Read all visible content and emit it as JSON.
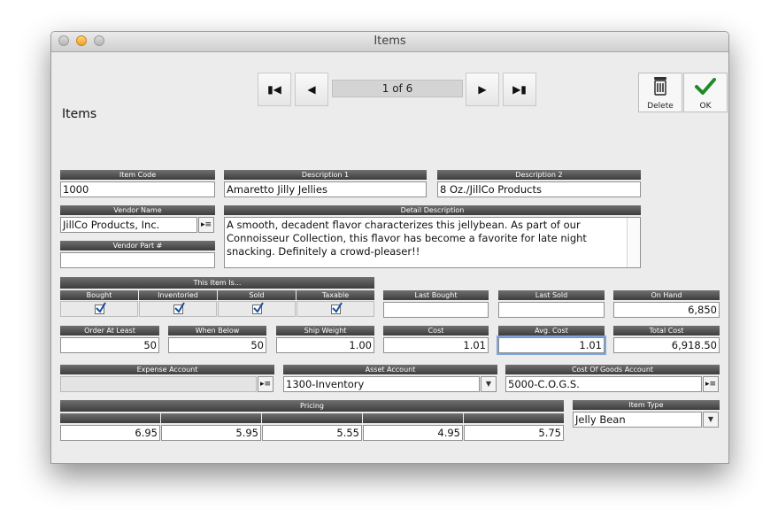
{
  "window": {
    "title": "Items"
  },
  "navigation": {
    "record_position": "1 of 6"
  },
  "toolbar": {
    "delete_label": "Delete",
    "ok_label": "OK"
  },
  "page": {
    "heading": "Items"
  },
  "fields": {
    "item_code": {
      "label": "Item Code",
      "value": "1000"
    },
    "description1": {
      "label": "Description 1",
      "value": "Amaretto Jilly Jellies"
    },
    "description2": {
      "label": "Description 2",
      "value": "8 Oz./JillCo Products"
    },
    "vendor_name": {
      "label": "Vendor Name",
      "value": "JillCo Products, Inc."
    },
    "vendor_part": {
      "label": "Vendor Part #",
      "value": ""
    },
    "detail_description": {
      "label": "Detail Description",
      "value": "A smooth, decadent flavor characterizes this jellybean. As part of our Connoisseur Collection, this flavor has become a favorite for late night snacking. Definitely a crowd-pleaser!!"
    },
    "last_bought": {
      "label": "Last Bought",
      "value": ""
    },
    "last_sold": {
      "label": "Last Sold",
      "value": ""
    },
    "on_hand": {
      "label": "On Hand",
      "value": "6,850"
    },
    "order_at_least": {
      "label": "Order At Least",
      "value": "50"
    },
    "when_below": {
      "label": "When Below",
      "value": "50"
    },
    "ship_weight": {
      "label": "Ship Weight",
      "value": "1.00"
    },
    "cost": {
      "label": "Cost",
      "value": "1.01"
    },
    "avg_cost": {
      "label": "Avg. Cost",
      "value": "1.01"
    },
    "total_cost": {
      "label": "Total Cost",
      "value": "6,918.50"
    },
    "expense_account": {
      "label": "Expense Account",
      "value": ""
    },
    "asset_account": {
      "label": "Asset Account",
      "value": "1300-Inventory"
    },
    "cogs_account": {
      "label": "Cost Of Goods Account",
      "value": "5000-C.O.G.S."
    },
    "item_type": {
      "label": "Item Type",
      "value": "Jelly Bean"
    }
  },
  "this_item_is": {
    "label": "This Item Is...",
    "options": [
      {
        "label": "Bought",
        "checked": true
      },
      {
        "label": "Inventoried",
        "checked": true
      },
      {
        "label": "Sold",
        "checked": true
      },
      {
        "label": "Taxable",
        "checked": true
      }
    ]
  },
  "pricing": {
    "label": "Pricing",
    "values": [
      "6.95",
      "5.95",
      "5.55",
      "4.95",
      "5.75"
    ]
  },
  "colors": {
    "checkmark": "#1e8a2a",
    "focus_ring": "#7ea6dd",
    "label_bar": "#4a4a4a"
  },
  "icons": [
    "first-record-icon",
    "previous-record-icon",
    "next-record-icon",
    "last-record-icon",
    "trash-icon",
    "checkmark-icon",
    "lookup-list-icon",
    "dropdown-arrow-icon"
  ]
}
